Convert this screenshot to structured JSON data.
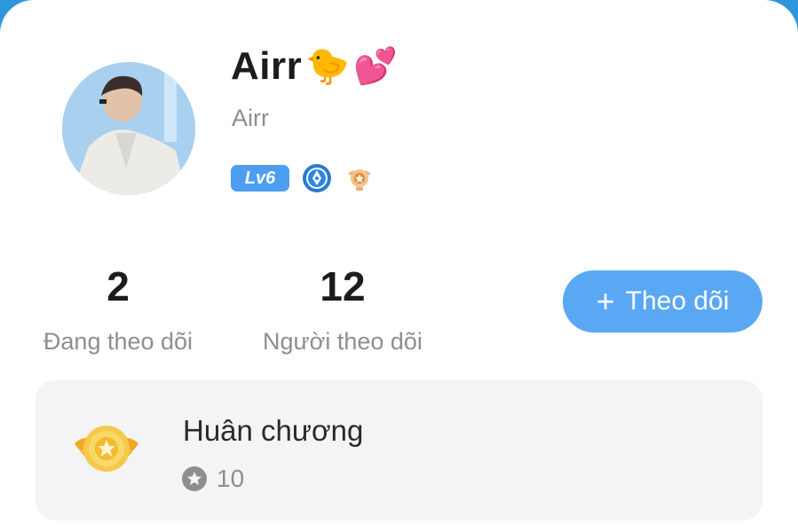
{
  "profile": {
    "display_name": "Airr",
    "name_emojis": [
      "🐤",
      "💕"
    ],
    "username": "Airr",
    "level_badge": "Lv6",
    "badge_icons": [
      "pen-nib-badge-icon",
      "medal-rank-badge-icon"
    ],
    "avatar_icon": "profile-photo"
  },
  "stats": {
    "following": {
      "value": "2",
      "label": "Đang theo dõi"
    },
    "followers": {
      "value": "12",
      "label": "Người theo dõi"
    }
  },
  "follow_button": {
    "icon": "plus-icon",
    "label": "Theo dõi"
  },
  "medals": {
    "title": "Huân chương",
    "icon": "winged-medal-icon",
    "count_icon": "star-circle-icon",
    "count": "10"
  },
  "colors": {
    "accent_blue": "#5aa8f3",
    "level_badge_blue": "#4d9df0",
    "header_blue": "#2f95dc",
    "muted_text": "#8e8e8e",
    "card_bg": "#f4f4f4"
  }
}
